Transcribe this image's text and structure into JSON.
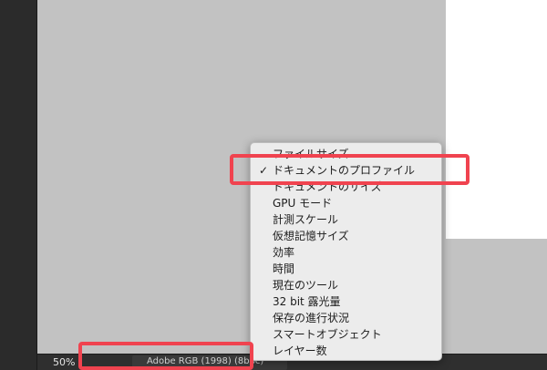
{
  "status_bar": {
    "zoom": "50%",
    "info": "Adobe RGB (1998) (8bpc)"
  },
  "menu": {
    "checked_index": 1,
    "check_glyph": "✓",
    "items": [
      "ファイルサイズ",
      "ドキュメントのプロファイル",
      "ドキュメントのサイズ",
      "GPU モード",
      "計測スケール",
      "仮想記憶サイズ",
      "効率",
      "時間",
      "現在のツール",
      "32 bit 露光量",
      "保存の進行状況",
      "スマートオブジェクト",
      "レイヤー数"
    ]
  },
  "colors": {
    "highlight": "#f0434f",
    "canvas": "#c2c2c2",
    "menu_bg": "#ececec",
    "status_bg": "#2f2f2f"
  }
}
